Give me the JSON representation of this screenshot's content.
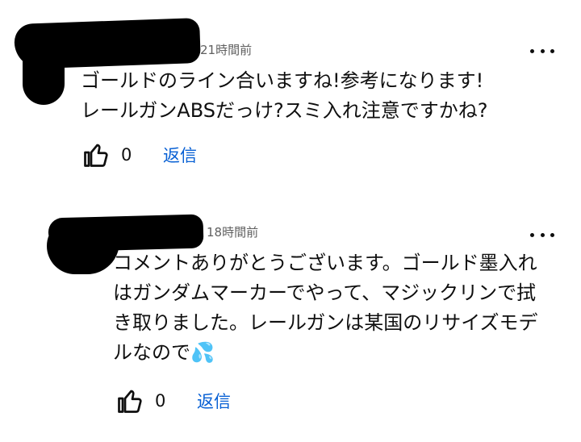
{
  "comments": [
    {
      "timestamp": "21時間前",
      "lines": [
        "ゴールドのライン合いますね!参考になります!",
        "レールガンABSだっけ?スミ入れ注意ですかね?"
      ],
      "like_count": "0",
      "reply_label": "返信",
      "like_icon": "thumbs-up-icon",
      "more_icon": "more-vert-icon"
    },
    {
      "timestamp": "18時間前",
      "lines": [
        "コメントありがとうございます。ゴールド墨入れ",
        "はガンダムマーカーでやって、マジックリンで拭",
        "き取りました。レールガンは某国のリサイズモデ",
        "ルなので💦"
      ],
      "like_count": "0",
      "reply_label": "返信",
      "like_icon": "thumbs-up-icon",
      "more_icon": "more-vert-icon"
    }
  ]
}
